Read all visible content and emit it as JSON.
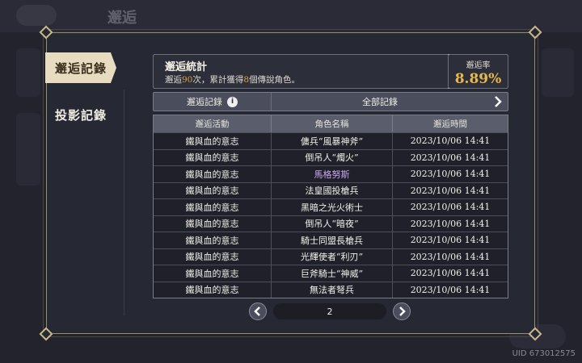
{
  "background": {
    "title": "邂逅",
    "uid": "UID 673012575"
  },
  "tabs": [
    {
      "label": "邂逅記錄",
      "active": true
    },
    {
      "label": "投影記錄",
      "active": false
    }
  ],
  "stats": {
    "title": "邂逅統計",
    "line_prefix": "邂逅",
    "count": "90",
    "line_mid": "次，累計獲得",
    "legend_count": "8",
    "line_suffix": "個傳說角色。",
    "rate_label": "邂逅率",
    "rate_value": "8.89%"
  },
  "filter": {
    "label": "邂逅記錄",
    "value": "全部記錄"
  },
  "table": {
    "headers": [
      "邂逅活動",
      "角色名稱",
      "邂逅時間"
    ],
    "rows": [
      {
        "event": "鐵與血的意志",
        "name": "傭兵“風暴神斧”",
        "time": "2023/10/06 14:41",
        "rare": false
      },
      {
        "event": "鐵與血的意志",
        "name": "倒吊人“燭火”",
        "time": "2023/10/06 14:41",
        "rare": false
      },
      {
        "event": "鐵與血的意志",
        "name": "馬格努斯",
        "time": "2023/10/06 14:41",
        "rare": true
      },
      {
        "event": "鐵與血的意志",
        "name": "法皇國投槍兵",
        "time": "2023/10/06 14:41",
        "rare": false
      },
      {
        "event": "鐵與血的意志",
        "name": "黑暗之光火術士",
        "time": "2023/10/06 14:41",
        "rare": false
      },
      {
        "event": "鐵與血的意志",
        "name": "倒吊人“暗夜”",
        "time": "2023/10/06 14:41",
        "rare": false
      },
      {
        "event": "鐵與血的意志",
        "name": "騎士同盟長槍兵",
        "time": "2023/10/06 14:41",
        "rare": false
      },
      {
        "event": "鐵與血的意志",
        "name": "光輝使者“利刃”",
        "time": "2023/10/06 14:41",
        "rare": false
      },
      {
        "event": "鐵與血的意志",
        "name": "巨斧騎士“神威”",
        "time": "2023/10/06 14:41",
        "rare": false
      },
      {
        "event": "鐵與血的意志",
        "name": "無法者弩兵",
        "time": "2023/10/06 14:41",
        "rare": false
      }
    ]
  },
  "pager": {
    "page": "2"
  },
  "colors": {
    "accent_gold": "#e8b84a",
    "highlight_orange": "#e0a040",
    "rare_purple": "#c9a6f0"
  }
}
